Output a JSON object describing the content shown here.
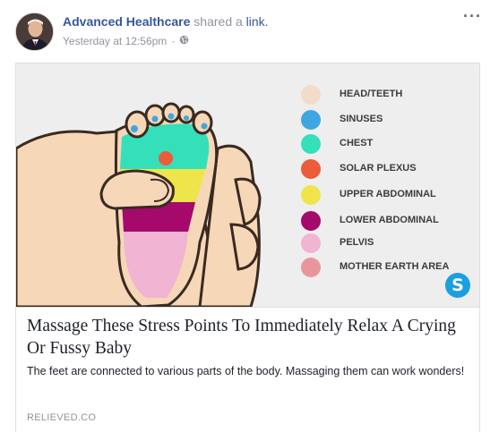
{
  "post": {
    "author": "Advanced Healthcare",
    "action_text": "shared a",
    "action_link": "link.",
    "timestamp": "Yesterday at 12:56pm",
    "separator": "·",
    "privacy_icon": "globe-icon",
    "more_icon": "more-options-icon",
    "more_label": "···"
  },
  "link_card": {
    "title": "Massage These Stress Points To Immediately Relax A Crying Or Fussy Baby",
    "description": "The feet are connected to various parts of the body. Massaging them can work wonders!",
    "domain": "RELIEVED.CO",
    "badge_letter": "S"
  },
  "legend": [
    {
      "label": "HEAD/TEETH",
      "color": "#f2dcc9"
    },
    {
      "label": "SINUSES",
      "color": "#3ea7e1"
    },
    {
      "label": "CHEST",
      "color": "#34e0b9"
    },
    {
      "label": "SOLAR PLEXUS",
      "color": "#ec5b3a"
    },
    {
      "label": "UPPER ABDOMINAL",
      "color": "#ede54a"
    },
    {
      "label": "LOWER ABDOMINAL",
      "color": "#a5096c"
    },
    {
      "label": "PELVIS",
      "color": "#f1b4d3"
    },
    {
      "label": "MOTHER EARTH AREA",
      "color": "#e8969c"
    }
  ],
  "colors": {
    "link_blue": "#365899",
    "meta_gray": "#90949c",
    "text": "#1d2129",
    "badge_blue": "#1a9fe0"
  }
}
